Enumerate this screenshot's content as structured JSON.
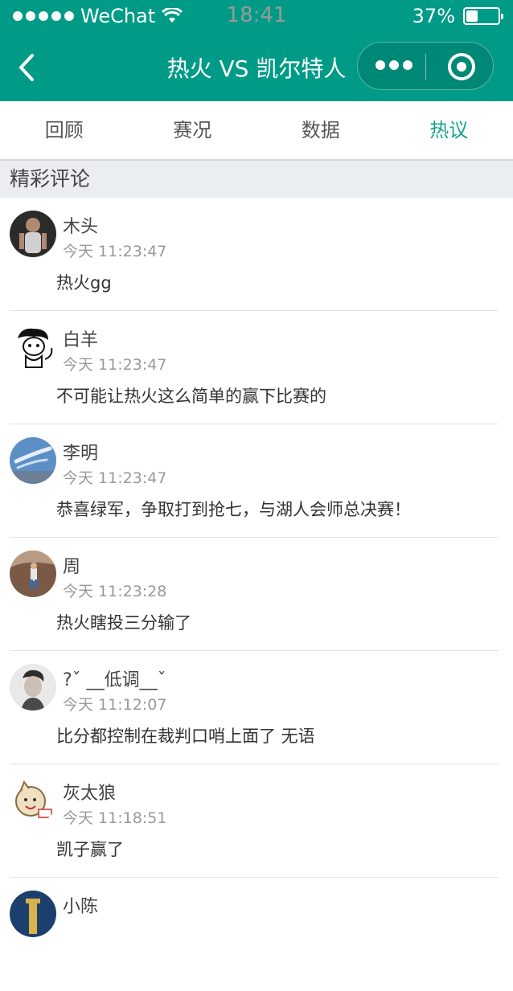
{
  "status": {
    "carrier": "WeChat",
    "time": "18:41",
    "battery": "37%"
  },
  "nav": {
    "title": "热火 VS 凯尔特人"
  },
  "tabs": [
    {
      "label": "回顾",
      "active": false
    },
    {
      "label": "赛况",
      "active": false
    },
    {
      "label": "数据",
      "active": false
    },
    {
      "label": "热议",
      "active": true
    }
  ],
  "section": {
    "title": "精彩评论"
  },
  "comments": [
    {
      "name": "木头",
      "time": "今天 11:23:47",
      "text": "热火gg"
    },
    {
      "name": "白羊",
      "time": "今天 11:23:47",
      "text": "不可能让热火这么简单的赢下比赛的"
    },
    {
      "name": "李明",
      "time": "今天 11:23:47",
      "text": "恭喜绿军，争取打到抢七，与湖人会师总决赛！"
    },
    {
      "name": "周",
      "time": "今天 11:23:28",
      "text": "热火瞎投三分输了"
    },
    {
      "name": "?ˇ __低调__ˇ",
      "time": "今天 11:12:07",
      "text": "比分都控制在裁判口哨上面了 无语"
    },
    {
      "name": "灰太狼",
      "time": "今天 11:18:51",
      "text": "凯子赢了"
    },
    {
      "name": "小陈",
      "time": "",
      "text": ""
    }
  ],
  "colors": {
    "brand": "#009b87",
    "active_tab": "#16a38f"
  }
}
